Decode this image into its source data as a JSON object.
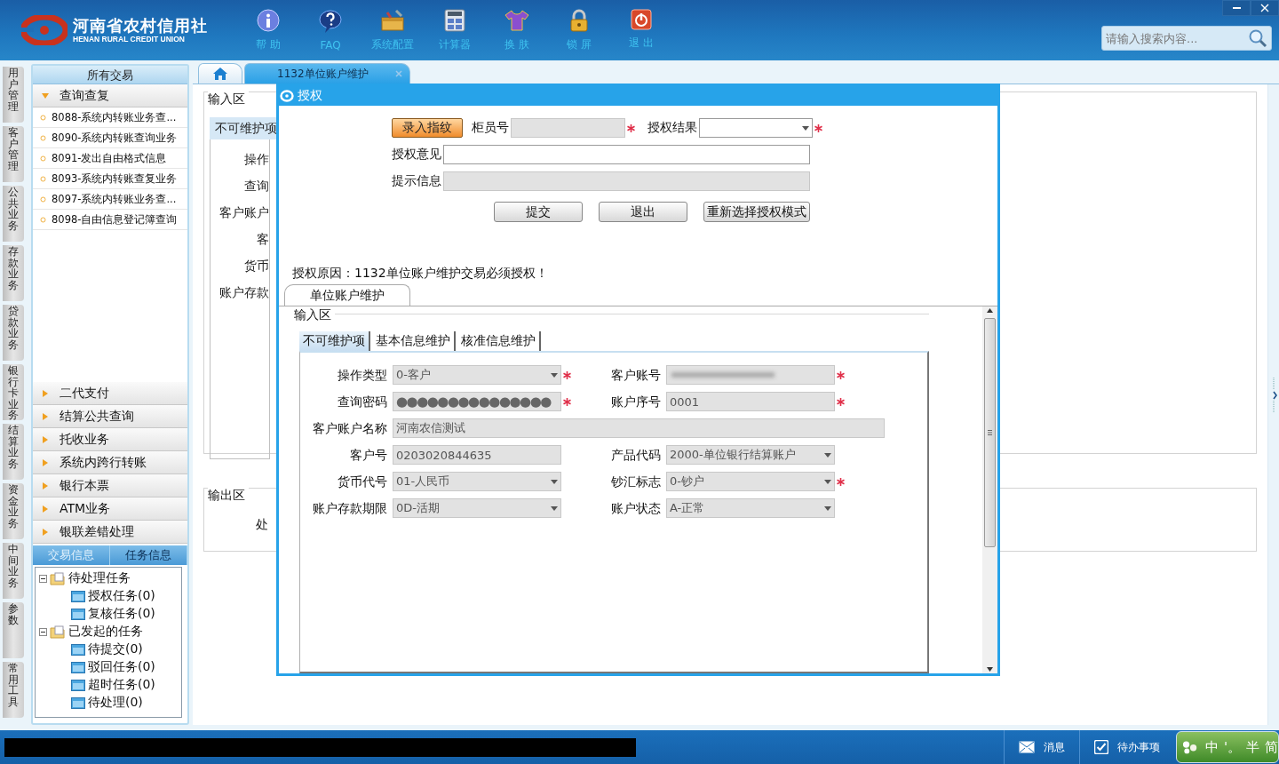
{
  "header": {
    "logo_cn": "河南省农村信用社",
    "logo_en": "HENAN RURAL CREDIT UNION",
    "toolbar": [
      {
        "kind": "info",
        "label": "帮 助"
      },
      {
        "kind": "faq",
        "label": "FAQ"
      },
      {
        "kind": "toolbox",
        "label": "系统配置"
      },
      {
        "kind": "calculator",
        "label": "计算器"
      },
      {
        "kind": "shirt",
        "label": "换 肤"
      },
      {
        "kind": "lock",
        "label": "锁 屏"
      },
      {
        "kind": "power",
        "label": "退 出"
      }
    ],
    "search": {
      "placeholder": "请输入搜索内容..."
    }
  },
  "side_tabs": [
    {
      "label": "用户管理"
    },
    {
      "label": "客户管理"
    },
    {
      "label": "公共业务"
    },
    {
      "label": "存款业务"
    },
    {
      "label": "贷款业务"
    },
    {
      "label": "银行卡业务"
    },
    {
      "label": "结算业务"
    },
    {
      "label": "资金业务"
    },
    {
      "label": "中间业务"
    },
    {
      "label": "参数"
    },
    {
      "label": "常用工具"
    }
  ],
  "nav": {
    "title": "所有交易",
    "groups": [
      {
        "label": "查询查复",
        "expanded": true,
        "items": [
          "8088-系统内转账业务查...",
          "8090-系统内转账查询业务",
          "8091-发出自由格式信息",
          "8093-系统内转账查复业务",
          "8097-系统内转账业务查...",
          "8098-自由信息登记簿查询"
        ]
      },
      {
        "label": "二代支付",
        "expanded": false
      },
      {
        "label": "结算公共查询",
        "expanded": false
      },
      {
        "label": "托收业务",
        "expanded": false
      },
      {
        "label": "系统内跨行转账",
        "expanded": false
      },
      {
        "label": "银行本票",
        "expanded": false
      },
      {
        "label": "ATM业务",
        "expanded": false
      },
      {
        "label": "银联差错处理",
        "expanded": false
      }
    ]
  },
  "info_panel": {
    "tabs": [
      {
        "label": "交易信息",
        "selected": false
      },
      {
        "label": "任务信息",
        "selected": true
      }
    ],
    "tree": [
      {
        "label": "待处理任务",
        "expanded": true,
        "children": [
          {
            "label": "授权任务(0)"
          },
          {
            "label": "复核任务(0)"
          }
        ]
      },
      {
        "label": "已发起的任务",
        "expanded": true,
        "children": [
          {
            "label": "待提交(0)"
          },
          {
            "label": "驳回任务(0)"
          },
          {
            "label": "超时任务(0)"
          },
          {
            "label": "待处理(0)"
          }
        ]
      }
    ]
  },
  "main_tabs": [
    {
      "kind": "home",
      "selected": false
    },
    {
      "kind": "page",
      "label": "1132单位账户维护",
      "selected": true
    }
  ],
  "background_form": {
    "input_legend": "输入区",
    "tab": "不可维护项",
    "labels": [
      "操作",
      "查询",
      "客户账户",
      "客",
      "货币",
      "账户存款"
    ],
    "output_legend": "输出区",
    "output_labels": [
      "处"
    ]
  },
  "dialog": {
    "title": "授权",
    "fingerprint_button": "录入指纹",
    "top_fields": [
      {
        "label": "柜员号",
        "kind": "text",
        "disabled": true,
        "required": true
      },
      {
        "label": "授权结果",
        "kind": "select",
        "disabled": false,
        "required": true
      }
    ],
    "wide_fields": [
      {
        "label": "授权意见",
        "disabled": false
      },
      {
        "label": "提示信息",
        "disabled": true
      }
    ],
    "buttons": [
      "提交",
      "退出",
      "重新选择授权模式"
    ],
    "reason": "授权原因：1132单位账户维护交易必须授权！",
    "tab": {
      "label": "单位账户维护",
      "selected": true
    },
    "form": {
      "legend": "输入区",
      "tabs": [
        {
          "label": "不可维护项",
          "selected": true
        },
        {
          "label": "基本信息维护",
          "selected": false
        },
        {
          "label": "核准信息维护",
          "selected": false
        }
      ],
      "fields": [
        {
          "label": "操作类型",
          "kind": "select",
          "value": "0-客户",
          "required": true,
          "disabled": true
        },
        {
          "label": "客户账号",
          "kind": "text",
          "redacted": true,
          "required": true,
          "disabled": true
        },
        {
          "label": "查询密码",
          "kind": "password",
          "value": "●●●●●●●●●●●●●●●",
          "required": true,
          "disabled": true
        },
        {
          "label": "账户序号",
          "kind": "text",
          "value": "0001",
          "required": true,
          "disabled": true
        },
        {
          "label": "客户账户名称",
          "kind": "wide",
          "value": "河南农信测试",
          "required": false,
          "disabled": true
        },
        {
          "label": "客户号",
          "kind": "text",
          "value": "0203020844635",
          "required": false,
          "disabled": true
        },
        {
          "label": "产品代码",
          "kind": "select",
          "value": "2000-单位银行结算账户",
          "required": false,
          "disabled": true
        },
        {
          "label": "货币代号",
          "kind": "select",
          "value": "01-人民币",
          "required": false,
          "disabled": true
        },
        {
          "label": "钞汇标志",
          "kind": "select",
          "value": "0-钞户",
          "required": true,
          "disabled": true
        },
        {
          "label": "账户存款期限",
          "kind": "select",
          "value": "0D-活期",
          "required": false,
          "disabled": true
        },
        {
          "label": "账户状态",
          "kind": "select",
          "value": "A-正常",
          "required": false,
          "disabled": true
        }
      ]
    }
  },
  "status_bar": {
    "items": [
      {
        "kind": "message",
        "label": "消息"
      },
      {
        "kind": "todo",
        "label": "待办事项"
      }
    ],
    "ime": [
      "中",
      "'。",
      "半",
      "简"
    ]
  }
}
